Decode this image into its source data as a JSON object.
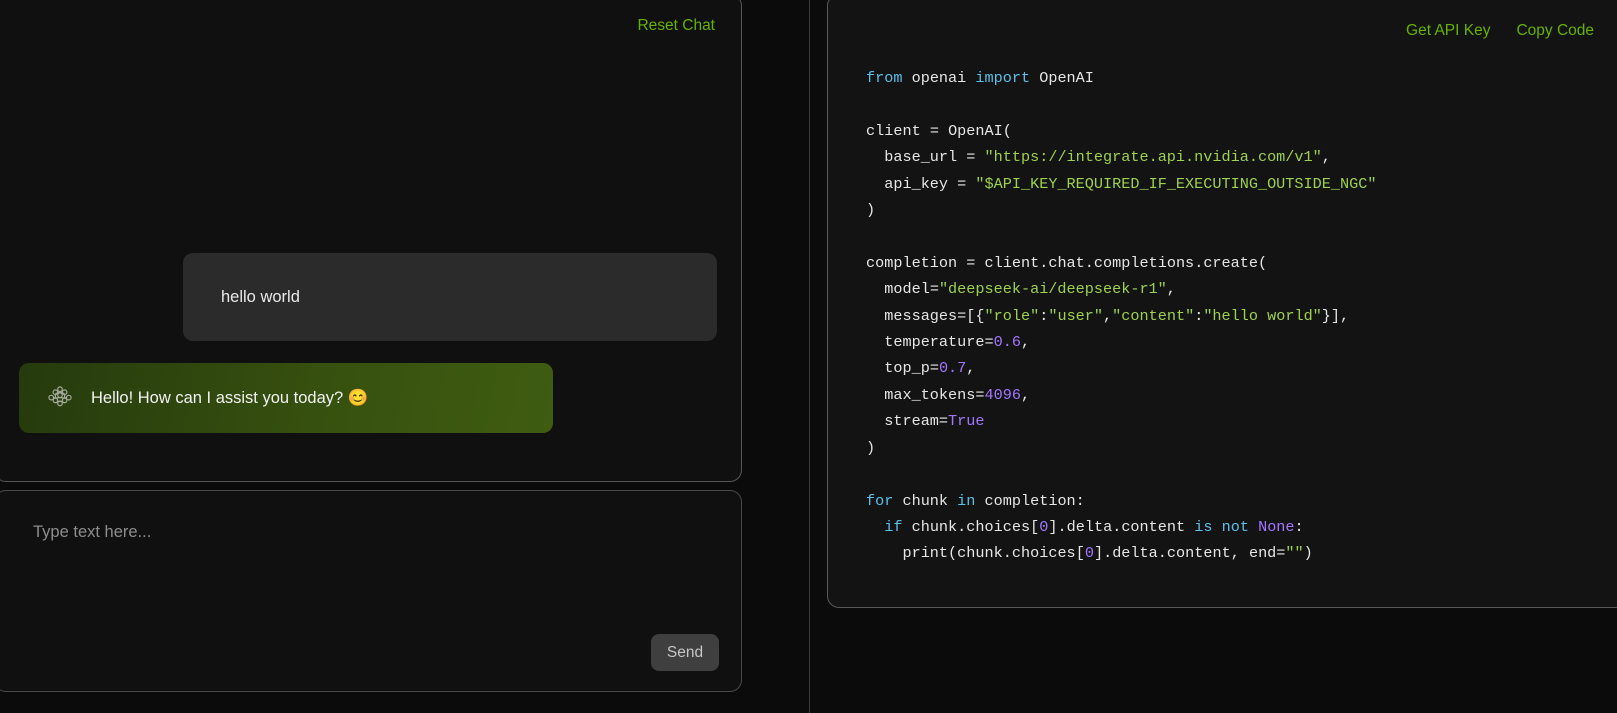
{
  "colors": {
    "accent_green": "#66b200",
    "bg": "#0b0b0b",
    "panel_bg": "#101010",
    "code_panel_bg": "#131313",
    "user_bubble": "#2b2b2b",
    "assistant_bubble_from": "#263a0d",
    "assistant_bubble_to": "#3f5d11",
    "send_button": "#3f3f3f",
    "code_string": "#9ed14d",
    "code_keyword": "#5bbfe8",
    "code_number": "#a277ff"
  },
  "chat": {
    "reset_label": "Reset Chat",
    "messages": [
      {
        "role": "user",
        "text": "hello world"
      },
      {
        "role": "assistant",
        "text": "Hello! How can I assist you today? 😊",
        "avatar_icon": "molecule-icon"
      }
    ]
  },
  "composer": {
    "placeholder": "Type text here...",
    "value": "",
    "send_label": "Send"
  },
  "code_panel": {
    "get_api_key_label": "Get API Key",
    "copy_code_label": "Copy Code",
    "language": "python",
    "lines": [
      "from openai import OpenAI",
      "",
      "client = OpenAI(",
      "  base_url = \"https://integrate.api.nvidia.com/v1\",",
      "  api_key = \"$API_KEY_REQUIRED_IF_EXECUTING_OUTSIDE_NGC\"",
      ")",
      "",
      "completion = client.chat.completions.create(",
      "  model=\"deepseek-ai/deepseek-r1\",",
      "  messages=[{\"role\":\"user\",\"content\":\"hello world\"}],",
      "  temperature=0.6,",
      "  top_p=0.7,",
      "  max_tokens=4096,",
      "  stream=True",
      ")",
      "",
      "for chunk in completion:",
      "  if chunk.choices[0].delta.content is not None:",
      "    print(chunk.choices[0].delta.content, end=\"\")"
    ],
    "params": {
      "model": "deepseek-ai/deepseek-r1",
      "base_url": "https://integrate.api.nvidia.com/v1",
      "api_key": "$API_KEY_REQUIRED_IF_EXECUTING_OUTSIDE_NGC",
      "temperature": "0.6",
      "top_p": "0.7",
      "max_tokens": "4096",
      "stream": "True",
      "message_role": "user",
      "message_content": "hello world"
    }
  }
}
